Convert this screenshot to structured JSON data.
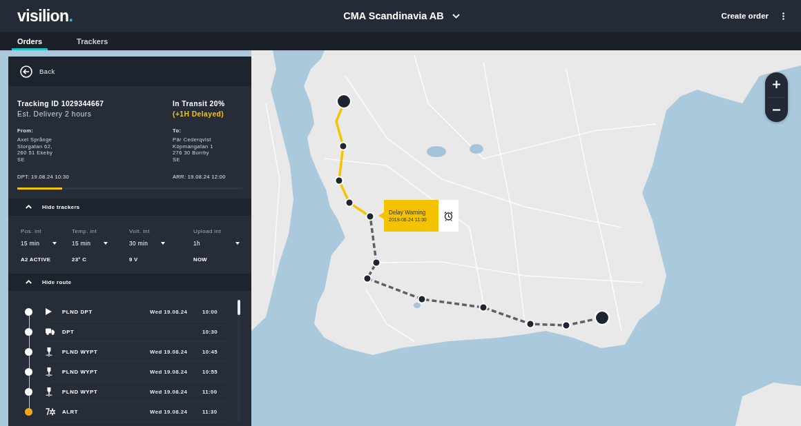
{
  "header": {
    "logo": "visilion.",
    "company": "CMA Scandinavia AB",
    "action": "Create order"
  },
  "tabs": [
    {
      "label": "Orders",
      "selected": true
    },
    {
      "label": "Trackers",
      "selected": false
    }
  ],
  "panel": {
    "back": "Back",
    "tracking_id": "Tracking ID 1029344667",
    "estimate": "Est. Delivery 2 hours",
    "status": "In Transit 20%",
    "delay": "(+1H Delayed)",
    "from": {
      "label": "From:",
      "lines": [
        "Axel Språnge",
        "Storgatan 62,",
        "260 51 Ekeby",
        "SE"
      ]
    },
    "to": {
      "label": "To:",
      "lines": [
        "Pär Cederqvist",
        "Köpmangatan 1",
        "276 30 Borrby",
        "SE"
      ]
    },
    "departure": "DPT: 19.08.24 10:30",
    "arrival": "ARR: 19.08.24 12:00",
    "progress": {
      "level": 0.2
    },
    "trackers_section": {
      "label": "Hide trackers",
      "expanded": true
    },
    "trackers": [
      {
        "label": "Pos. int",
        "value": "15 min",
        "reading": "A2 ACTIVE"
      },
      {
        "label": "Temp. int",
        "value": "15 min",
        "reading": "23° C"
      },
      {
        "label": "Volt. int",
        "value": "30 min",
        "reading": "9 V"
      },
      {
        "label": "Upload int",
        "value": "1h",
        "reading": "NOW"
      }
    ],
    "route_section": {
      "label": "Hide route",
      "expanded": true
    },
    "route": [
      {
        "kind": "start",
        "label": "PLND DPT",
        "date": "Wed 19.08.24",
        "time": "10:00",
        "color": "#ffffff"
      },
      {
        "kind": "truck",
        "label": "DPT",
        "time": "10:30",
        "color": "#ffffff"
      },
      {
        "kind": "waypoint",
        "label": "PLND WYPT",
        "date": "Wed 19.08.24",
        "time": "10:45",
        "color": "#ffffff"
      },
      {
        "kind": "waypoint",
        "label": "PLND WYPT",
        "date": "Wed 19.08.24",
        "time": "10:55",
        "color": "#ffffff"
      },
      {
        "kind": "waypoint",
        "label": "PLND WYPT",
        "date": "Wed 19.08.24",
        "time": "11:00",
        "color": "#ffffff"
      },
      {
        "kind": "alert",
        "label": "ALRT",
        "date": "Wed 19.08.24",
        "time": "11:30",
        "color": "#f4a81d"
      }
    ]
  },
  "map": {
    "popup": {
      "title": "Delay Warning",
      "time": "2019-08-24 11:30"
    }
  }
}
